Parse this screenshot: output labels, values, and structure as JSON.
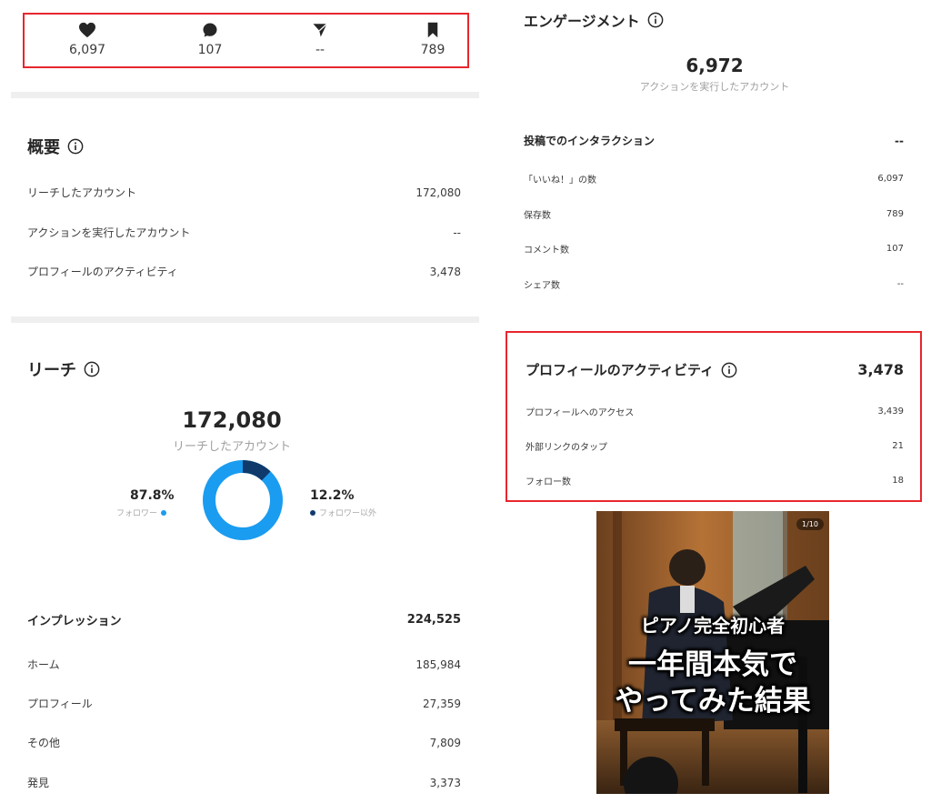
{
  "stats": {
    "likes": "6,097",
    "comments": "107",
    "shares": "--",
    "saves": "789"
  },
  "overview": {
    "title": "概要",
    "rows": [
      {
        "label": "リーチしたアカウント",
        "value": "172,080"
      },
      {
        "label": "アクションを実行したアカウント",
        "value": "--"
      },
      {
        "label": "プロフィールのアクティビティ",
        "value": "3,478"
      }
    ]
  },
  "reach": {
    "title": "リーチ",
    "total": "172,080",
    "subtitle": "リーチしたアカウント",
    "followers_pct": "87.8%",
    "followers_label": "フォロワー",
    "nonfollowers_pct": "12.2%",
    "nonfollowers_label": "フォロワー以外",
    "followers_fraction": 0.878,
    "impressions": {
      "label": "インプレッション",
      "value": "224,525",
      "rows": [
        {
          "label": "ホーム",
          "value": "185,984"
        },
        {
          "label": "プロフィール",
          "value": "27,359"
        },
        {
          "label": "その他",
          "value": "7,809"
        },
        {
          "label": "発見",
          "value": "3,373"
        }
      ]
    }
  },
  "engagement": {
    "title": "エンゲージメント",
    "total": "6,972",
    "subtitle": "アクションを実行したアカウント",
    "interactions_label": "投稿でのインタラクション",
    "interactions_value": "--",
    "rows": [
      {
        "label": "「いいね！」の数",
        "value": "6,097"
      },
      {
        "label": "保存数",
        "value": "789"
      },
      {
        "label": "コメント数",
        "value": "107"
      },
      {
        "label": "シェア数",
        "value": "--"
      }
    ]
  },
  "profile_activity": {
    "title": "プロフィールのアクティビティ",
    "value": "3,478",
    "rows": [
      {
        "label": "プロフィールへのアクセス",
        "value": "3,439"
      },
      {
        "label": "外部リンクのタップ",
        "value": "21"
      },
      {
        "label": "フォロー数",
        "value": "18"
      }
    ]
  },
  "thumbnail": {
    "badge": "1/10",
    "line1": "ピアノ完全初心者",
    "line2": "一年間本気で",
    "line3": "やってみた結果"
  },
  "colors": {
    "highlight": "#e8262e",
    "followers": "#1a9cf0",
    "nonfollowers": "#0f3a6b"
  }
}
